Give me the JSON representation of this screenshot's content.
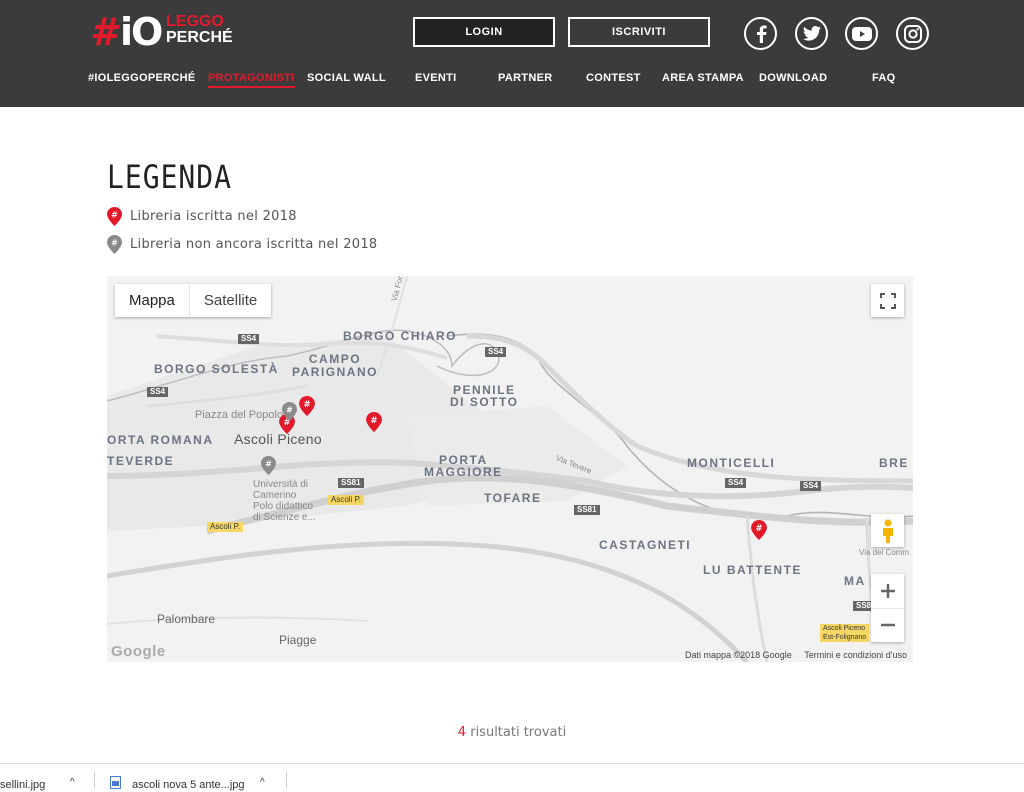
{
  "brand": {
    "hash": "#",
    "io": "iO",
    "leggo": "LEGGO",
    "perche": "PERCHÉ"
  },
  "header": {
    "login_label": "LOGIN",
    "signup_label": "ISCRIVITI",
    "nav": [
      "#IOLEGGOPERCHÉ",
      "PROTAGONISTI",
      "SOCIAL WALL",
      "EVENTI",
      "PARTNER",
      "CONTEST",
      "AREA STAMPA",
      "DOWNLOAD",
      "FAQ"
    ],
    "active_nav": "PROTAGONISTI"
  },
  "legend": {
    "title": "LEGENDA",
    "enrolled": "Libreria iscritta nel 2018",
    "not_enrolled": "Libreria non ancora iscritta nel 2018"
  },
  "map": {
    "type_map": "Mappa",
    "type_satellite": "Satellite",
    "places": {
      "borgo_chiaro": "BORGO CHIARO",
      "campo_parignano": "CAMPO\nPARIGNANO",
      "borgo_solesta": "BORGO SOLESTÀ",
      "pennile": "PENNILE\nDI SOTTO",
      "piazza": "Piazza del Popolo",
      "orta_romana": "ORTA ROMANA",
      "ascoli": "Ascoli Piceno",
      "teverde": "TEVERDE",
      "porta_maggiore": "PORTA\nMAGGIORE",
      "monticelli": "MONTICELLI",
      "bre": "BRE",
      "tofare": "TOFARE",
      "universita": "Università di\nCamerino\nPolo didattico\ndi Scienze e...",
      "castagneti": "CASTAGNETI",
      "lu_battente": "LU BATTENTE",
      "ma": "MA",
      "palombare": "Palombare",
      "piagge": "Piagge",
      "via_tevere": "Via Tevere",
      "via_forte": "Via Forte",
      "via_del_comm": "Via del Comm",
      "ascoli_est": "Ascoli Piceno\nEst-Folignano"
    },
    "roads": {
      "ss4": "SS4",
      "ss81": "SS81",
      "ascoli_p": "Ascoli P."
    },
    "attribution": "Dati mappa ©2018 Google",
    "terms": "Termini e condizioni d'uso",
    "google": "Google"
  },
  "results": {
    "count": "4",
    "label": "risultati trovati"
  },
  "downloads": {
    "file1": "sellini.jpg",
    "file2": "ascoli nova 5 ante...jpg"
  },
  "colors": {
    "accent": "#e2192b",
    "header_bg": "#3b3b3b"
  }
}
